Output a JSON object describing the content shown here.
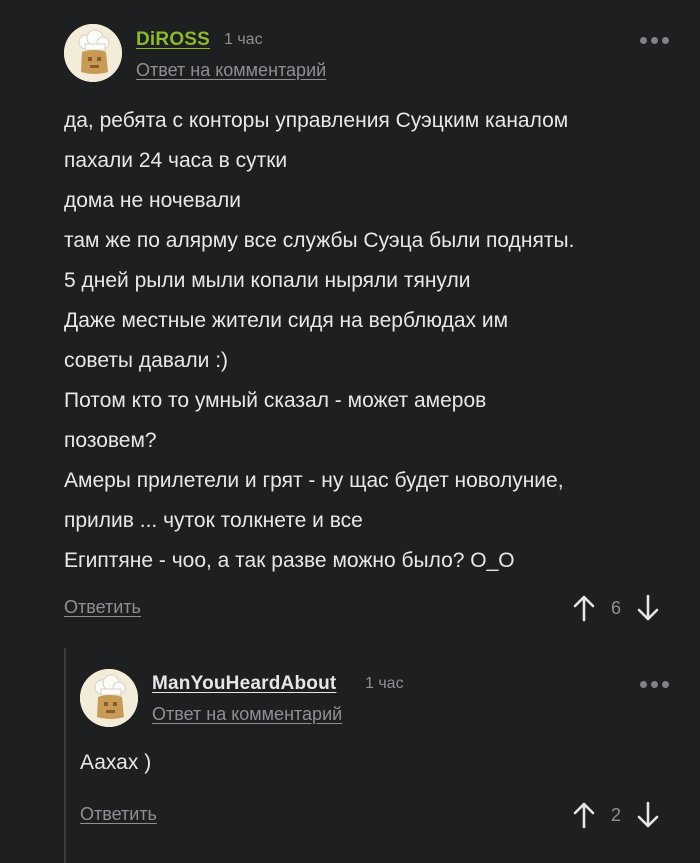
{
  "comments": [
    {
      "username": "DiROSS",
      "username_color": "#8bb82d",
      "time": "1 час",
      "reply_to_label": "Ответ на комментарий",
      "lines": [
        "да, ребята с конторы управления Суэцким каналом",
        "пахали 24 часа в сутки",
        "дома не ночевали",
        "там же по алярму все службы Суэца были подняты.",
        "5 дней рыли мыли копали ныряли тянули",
        "Даже местные жители сидя на верблюдах им",
        "советы давали :)",
        "Потом кто то умный сказал - может амеров",
        "позовем?",
        "Амеры прилетели и грят - ну щас будет новолуние,",
        "прилив ... чуток толкнете и все",
        "Египтяне - чоо, а так разве можно было? О_О"
      ],
      "answer_label": "Ответить",
      "rating": "6",
      "up_icon": "arrow-up-icon",
      "down_icon": "arrow-down-icon",
      "more_icon": "more-dots-icon"
    },
    {
      "username": "ManYouHeardAbout",
      "username_color": "#e6e6e6",
      "time": "1 час",
      "reply_to_label": "Ответ на комментарий",
      "lines": [
        "Аахах )"
      ],
      "answer_label": "Ответить",
      "rating": "2",
      "up_icon": "arrow-up-icon",
      "down_icon": "arrow-down-icon",
      "more_icon": "more-dots-icon"
    }
  ]
}
